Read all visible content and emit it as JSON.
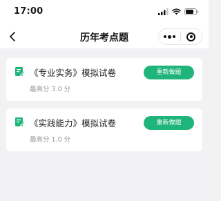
{
  "status_bar": {
    "time": "17:00",
    "icons": [
      "signal-icon",
      "wifi-icon",
      "battery-icon"
    ]
  },
  "nav": {
    "title": "历年考点题",
    "back_icon": "chevron-left-icon",
    "capsule_more_icon": "more-dots-icon",
    "capsule_close_icon": "target-close-icon"
  },
  "exams": [
    {
      "title": "《专业实务》模拟试卷",
      "score": "最高分 3.0 分",
      "button_label": "重新做题",
      "icon": "edit-document-icon"
    },
    {
      "title": "《实践能力》模拟试卷",
      "score": "最高分 1.0 分",
      "button_label": "重新做题",
      "icon": "edit-document-icon"
    }
  ],
  "colors": {
    "accent": "#1fb47a",
    "background": "#f2f2f4",
    "card": "#ffffff",
    "muted_text": "#9a9a9a"
  }
}
